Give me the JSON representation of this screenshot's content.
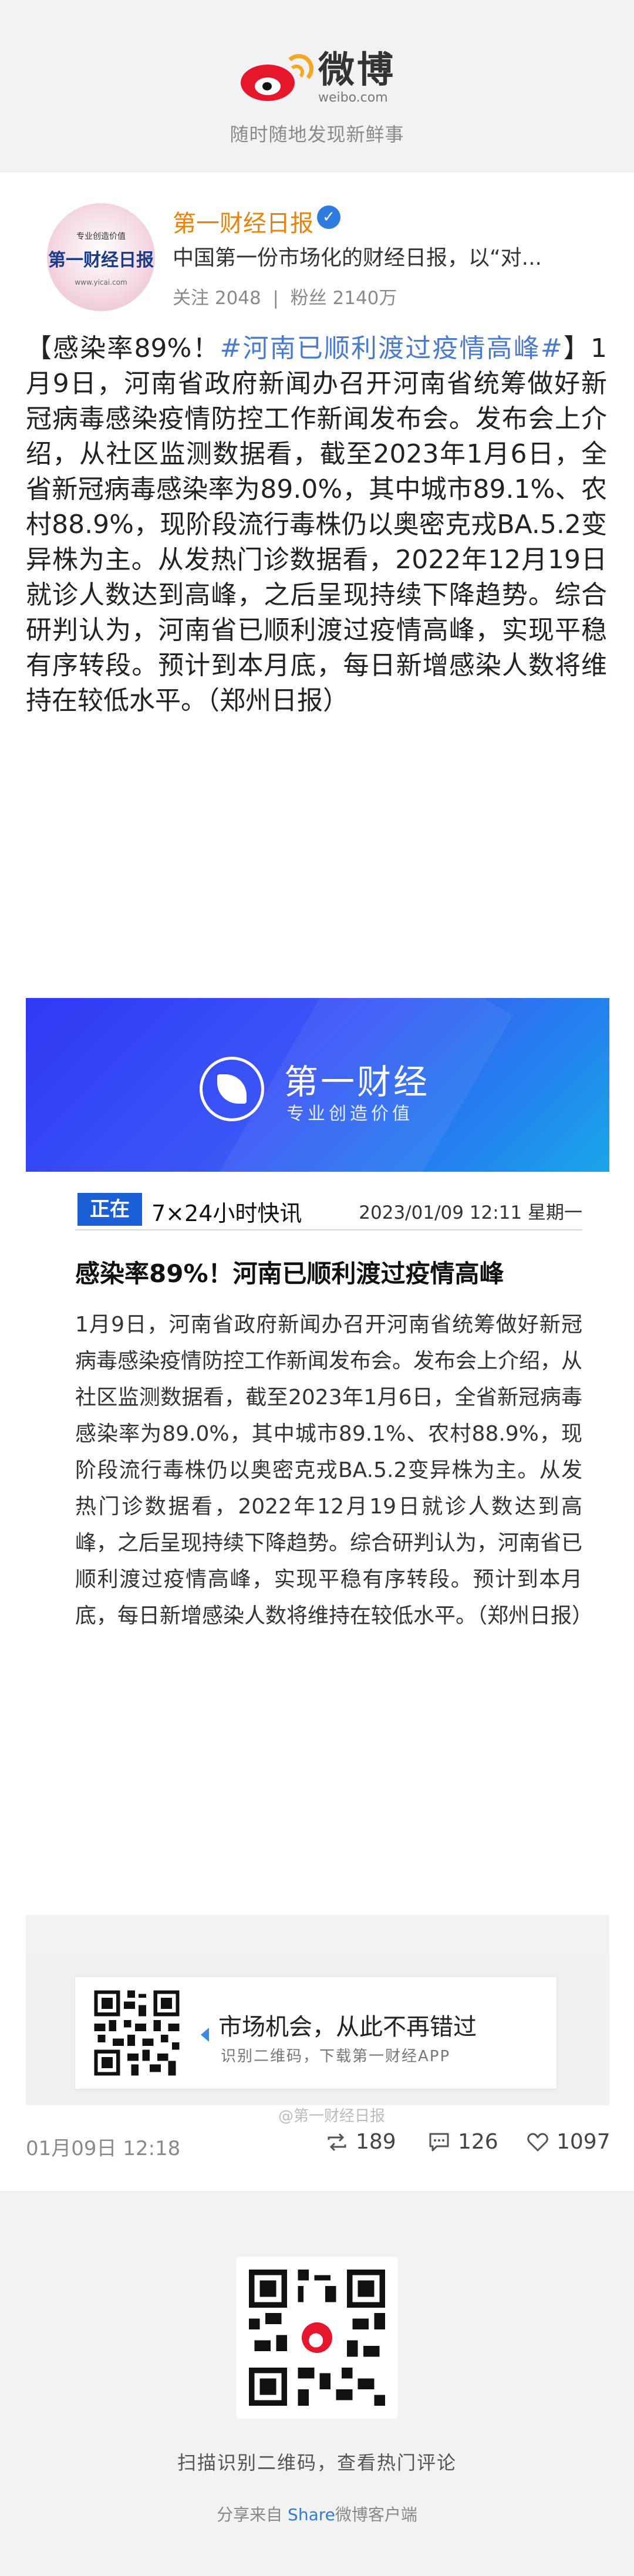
{
  "header": {
    "brand_cn": "微博",
    "brand_en": "weibo.com",
    "tagline": "随时随地发现新鲜事"
  },
  "profile": {
    "avatar_top": "专业创造价值",
    "avatar_name": "第一财经日报",
    "avatar_url": "www.yicai.com",
    "name": "第一财经日报",
    "verified_mark": "✓",
    "description": "中国第一份市场化的财经日报，以“对...",
    "following_label": "关注",
    "following": "2048",
    "followers_label": "粉丝",
    "followers": "2140万"
  },
  "post": {
    "lead": "【感染率89%！",
    "hashtag": "#河南已顺利渡过疫情高峰#",
    "body": "】1月9日，河南省政府新闻办召开河南省统筹做好新冠病毒感染疫情防控工作新闻发布会。发布会上介绍，从社区监测数据看，截至2023年1月6日，全省新冠病毒感染率为89.0%，其中城市89.1%、农村88.9%，现阶段流行毒株仍以奥密克戎BA.5.2变异株为主。从发热门诊数据看，2022年12月19日就诊人数达到高峰，之后呈现持续下降趋势。综合研判认为，河南省已顺利渡过疫情高峰，实现平稳有序转段。预计到本月底，每日新增感染人数将维持在较低水平。（郑州日报）"
  },
  "banner": {
    "title": "第一财经",
    "subtitle": "专业创造价值"
  },
  "news": {
    "logo_text": "正在",
    "header_title": "7×24小时快讯",
    "date": "2023/01/09 12:11 星期一",
    "title": "感染率89%！河南已顺利渡过疫情高峰",
    "body": "1月9日，河南省政府新闻办召开河南省统筹做好新冠病毒感染疫情防控工作新闻发布会。发布会上介绍，从社区监测数据看，截至2023年1月6日，全省新冠病毒感染率为89.0%，其中城市89.1%、农村88.9%，现阶段流行毒株仍以奥密克戎BA.5.2变异株为主。从发热门诊数据看，2022年12月19日就诊人数达到高峰，之后呈现持续下降趋势。综合研判认为，河南省已顺利渡过疫情高峰，实现平稳有序转段。预计到本月底，每日新增感染人数将维持在较低水平。（郑州日报）"
  },
  "promo": {
    "title": "市场机会，从此不再错过",
    "subtitle": "识别二维码，下载第一财经APP",
    "watermark": "@第一财经日报"
  },
  "footer": {
    "time": "01月09日 12:18",
    "reposts": "189",
    "comments": "126",
    "likes": "1097"
  },
  "qr_section": {
    "caption": "扫描识别二维码，查看热门评论",
    "share_prefix": "分享来自",
    "share_word": "Share",
    "share_suffix": "微博客户端"
  },
  "colors": {
    "weibo_red": "#e6162d",
    "name_orange": "#e8830e",
    "hashtag_blue": "#4a7bcf",
    "banner_blue": "#2f39f5"
  }
}
